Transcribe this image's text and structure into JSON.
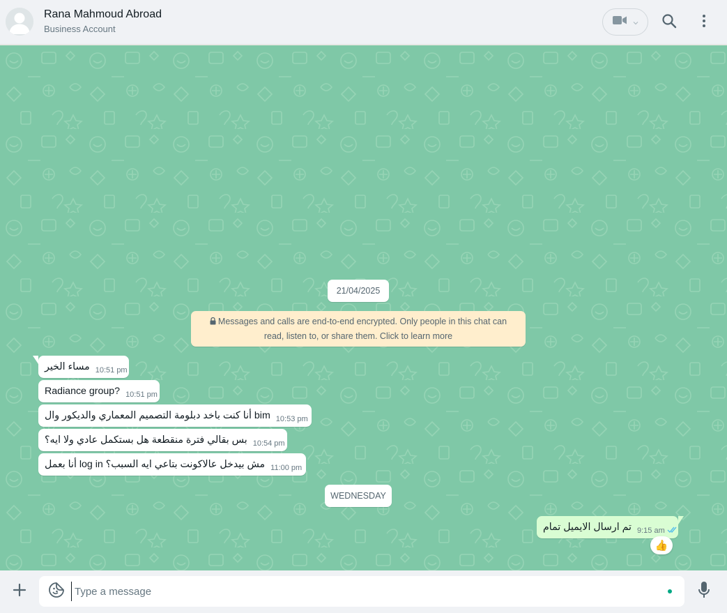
{
  "header": {
    "contact_name": "Rana Mahmoud Abroad",
    "contact_subtitle": "Business Account"
  },
  "chat": {
    "date_chip_1": "21/04/2025",
    "encryption_notice": "Messages and calls are end-to-end encrypted. Only people in this chat can read, listen to, or share them. Click to learn more",
    "messages": [
      {
        "direction": "in",
        "text": "مساء الخير",
        "time": "10:51 pm"
      },
      {
        "direction": "in",
        "text": "Radiance group?",
        "time": "10:51 pm"
      },
      {
        "direction": "in",
        "text": "أنا كنت باخد دبلومة التصميم المعماري والديكور وال bim",
        "time": "10:53 pm"
      },
      {
        "direction": "in",
        "text": "بس بقالي فترة منقطعة هل بستكمل عادي ولا ايه؟",
        "time": "10:54 pm"
      },
      {
        "direction": "in",
        "text": "أنا بعمل log in مش بيدخل عالاكونت بتاعي ايه السبب؟",
        "time": "11:00 pm"
      }
    ],
    "date_chip_2": "WEDNESDAY",
    "outgoing": {
      "text": "تم ارسال الايميل تمام",
      "time": "9:15 am",
      "reaction": "👍"
    }
  },
  "footer": {
    "placeholder": "Type a message"
  },
  "colors": {
    "chat_bg": "#7fc8a7",
    "outgoing_bubble": "#d9fdd3",
    "encryption_bg": "#ffeecd",
    "read_ticks": "#53bdeb",
    "accent": "#00a884"
  }
}
